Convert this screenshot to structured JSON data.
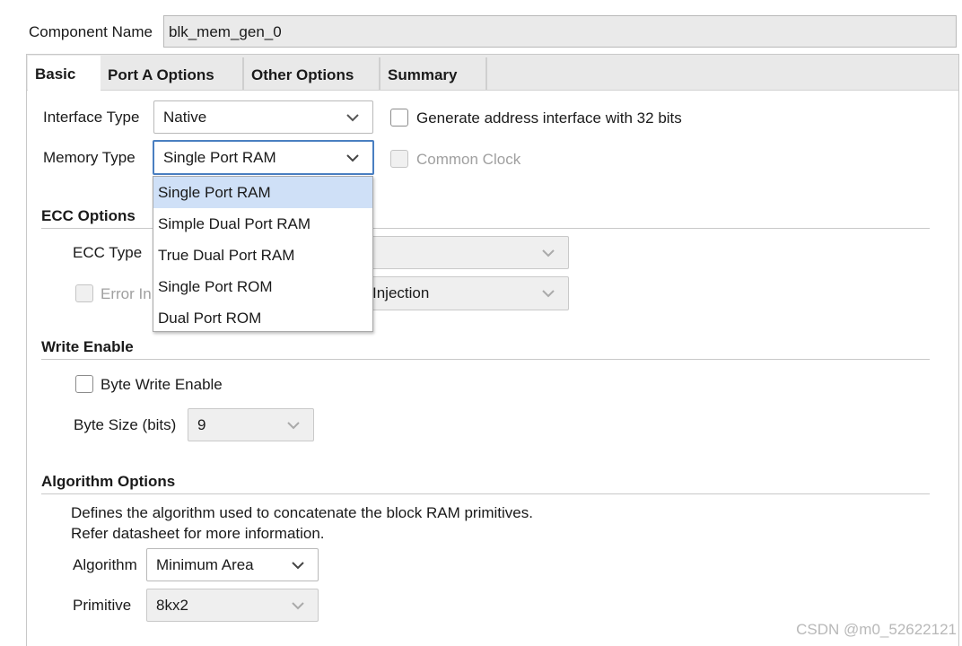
{
  "component": {
    "label": "Component Name",
    "value": "blk_mem_gen_0"
  },
  "tabs": [
    {
      "label": "Basic",
      "active": true
    },
    {
      "label": "Port A Options",
      "active": false
    },
    {
      "label": "Other Options",
      "active": false
    },
    {
      "label": "Summary",
      "active": false
    }
  ],
  "basic": {
    "interface_type": {
      "label": "Interface Type",
      "value": "Native"
    },
    "memory_type": {
      "label": "Memory Type",
      "value": "Single Port RAM"
    },
    "generate_address": {
      "label": "Generate address interface with 32 bits",
      "checked": false
    },
    "common_clock": {
      "label": "Common Clock",
      "checked": false,
      "enabled": false
    }
  },
  "memory_type_options": [
    "Single Port RAM",
    "Simple Dual Port RAM",
    "True Dual Port RAM",
    "Single Port ROM",
    "Dual Port ROM"
  ],
  "ecc": {
    "title": "ECC Options",
    "type_label": "ECC Type",
    "type_value": "",
    "error_label_partial": "Error In",
    "error_select_partial": "Injection"
  },
  "write_enable": {
    "title": "Write Enable",
    "byte_write_label": "Byte Write Enable",
    "byte_size_label": "Byte Size (bits)",
    "byte_size_value": "9"
  },
  "algorithm": {
    "title": "Algorithm Options",
    "description_line1": "Defines the algorithm used to concatenate the block RAM primitives.",
    "description_line2": "Refer datasheet for more information.",
    "algorithm_label": "Algorithm",
    "algorithm_value": "Minimum Area",
    "primitive_label": "Primitive",
    "primitive_value": "8kx2"
  },
  "watermark": "CSDN @m0_52622121",
  "colors": {
    "accent_border": "#4a7fc1",
    "selected_item": "#cfe0f7",
    "tab_strip": "#e9e9e9"
  }
}
